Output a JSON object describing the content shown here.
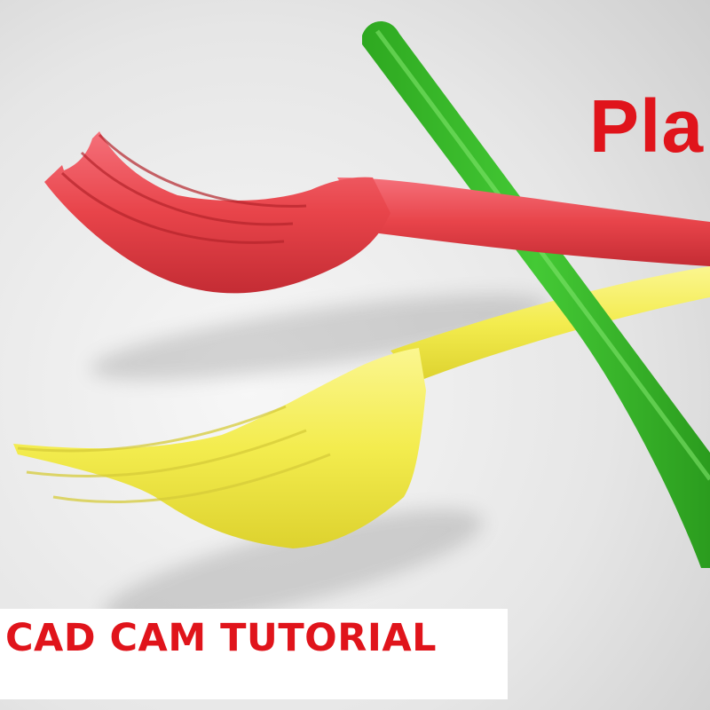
{
  "title_partial": "Pla",
  "footer_text": "CAD CAM TUTORIAL",
  "colors": {
    "text_red": "#e0141b",
    "fork_red": "#e8444a",
    "fork_yellow": "#f6ef5a",
    "fork_green": "#3bbf2a",
    "background": "#eeeeee"
  },
  "objects": [
    "red-plastic-fork",
    "yellow-plastic-fork",
    "green-plastic-fork"
  ]
}
